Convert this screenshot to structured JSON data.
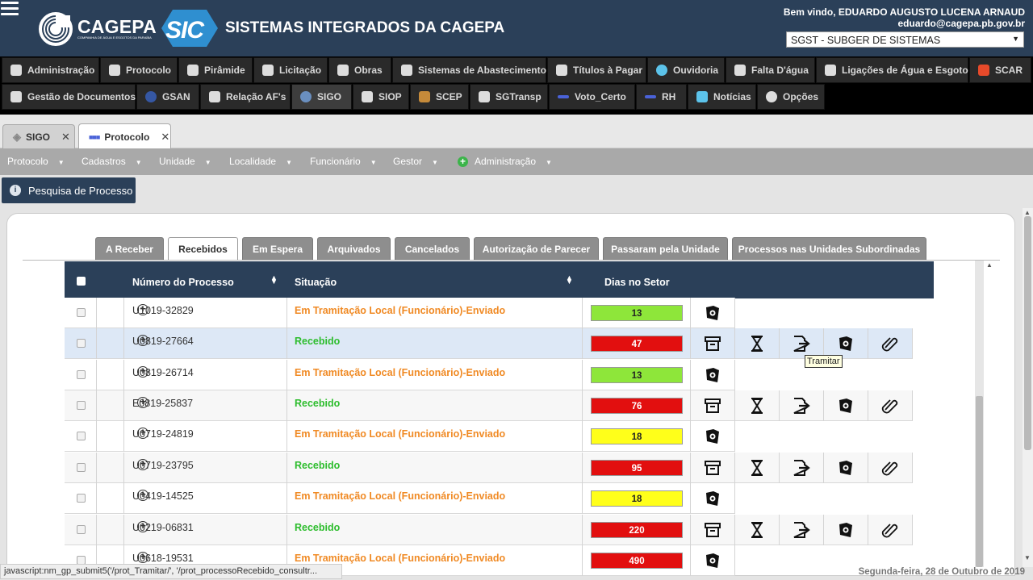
{
  "header": {
    "company": "CAGEPA",
    "company_subtitle": "COMPANHIA DE ÁGUA E ESGOTOS DA PARAÍBA",
    "sic_logo_text": "SIC",
    "system_title": "SISTEMAS INTEGRADOS DA CAGEPA",
    "welcome": "Bem vindo, EDUARDO AUGUSTO LUCENA ARNAUD",
    "email": "eduardo@cagepa.pb.gov.br",
    "system_select": "SGST - SUBGER DE SISTEMAS",
    "brand_color": "#2b4059"
  },
  "menu_row1": [
    "Administração",
    "Protocolo",
    "Pirâmide",
    "Licitação",
    "Obras",
    "Sistemas de Abastecimento",
    "Títulos à Pagar",
    "Ouvidoria",
    "Falta D'água",
    "Ligações de Água e Esgoto",
    "SCAR"
  ],
  "menu_row2": [
    "Gestão de Documentos",
    "GSAN",
    "Relação AF's",
    "SIGO",
    "SIOP",
    "SCEP",
    "SGTransp",
    "Voto_Certo",
    "RH",
    "Notícias",
    "Opções"
  ],
  "open_tabs": [
    {
      "label": "SIGO",
      "close": "✕"
    },
    {
      "label": "Protocolo",
      "close": "✕"
    }
  ],
  "submenu": [
    "Protocolo",
    "Cadastros",
    "Unidade",
    "Localidade",
    "Funcionário",
    "Gestor",
    "Administração"
  ],
  "search_button": "Pesquisa de Processo",
  "result_tabs": [
    "A Receber",
    "Recebidos",
    "Em Espera",
    "Arquivados",
    "Cancelados",
    "Autorização de Parecer",
    "Passaram pela Unidade",
    "Processos nas Unidades Subordinadas"
  ],
  "table": {
    "headers": {
      "numero": "Número do Processo",
      "situacao": "Situação",
      "dias": "Dias no Setor"
    },
    "rows": [
      {
        "numero": "U1019-32829",
        "situacao": "Em Tramitação Local (Funcionário)-Enviado",
        "dias": "13",
        "dias_color": "#8ee63a"
      },
      {
        "numero": "U0819-27664",
        "situacao": "Recebido",
        "dias": "47",
        "dias_color": "#e20f0f"
      },
      {
        "numero": "U0819-26714",
        "situacao": "Em Tramitação Local (Funcionário)-Enviado",
        "dias": "13",
        "dias_color": "#8ee63a"
      },
      {
        "numero": "E0819-25837",
        "situacao": "Recebido",
        "dias": "76",
        "dias_color": "#e20f0f"
      },
      {
        "numero": "U0719-24819",
        "situacao": "Em Tramitação Local (Funcionário)-Enviado",
        "dias": "18",
        "dias_color": "#ffff1a"
      },
      {
        "numero": "U0719-23795",
        "situacao": "Recebido",
        "dias": "95",
        "dias_color": "#e20f0f"
      },
      {
        "numero": "U0419-14525",
        "situacao": "Em Tramitação Local (Funcionário)-Enviado",
        "dias": "18",
        "dias_color": "#ffff1a"
      },
      {
        "numero": "U0219-06831",
        "situacao": "Recebido",
        "dias": "220",
        "dias_color": "#e20f0f"
      },
      {
        "numero": "U0618-19531",
        "situacao": "Em Tramitação Local (Funcionário)-Enviado",
        "dias": "490",
        "dias_color": "#e20f0f"
      }
    ],
    "status_colors": {
      "enviado": "#f08a24",
      "recebido": "#2dbd2d"
    }
  },
  "tooltip": "Tramitar",
  "status_url": "javascript:nm_gp_submit5('/prot_Tramitar/', '/prot_processoRecebido_consultr...",
  "date": "Segunda-feira, 28 de Outubro de 2019"
}
